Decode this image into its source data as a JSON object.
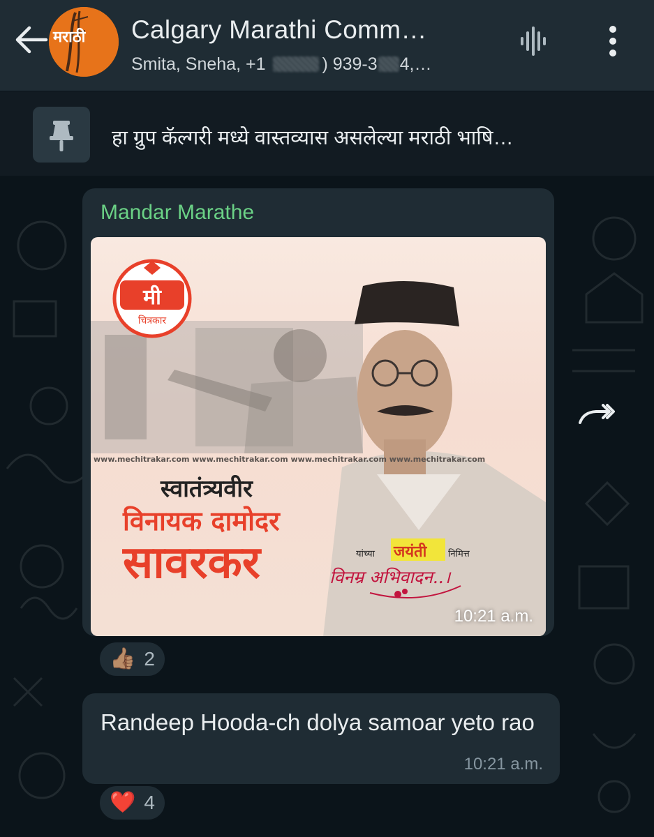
{
  "header": {
    "back_icon": "arrow-left-icon",
    "title": "Calgary Marathi Comm…",
    "subtitle_start": "Smita, Sneha, +1",
    "subtitle_end": ") 939-3",
    "subtitle_tail": "4,…",
    "voice_icon": "voice-waveform-icon",
    "menu_icon": "more-vertical-icon",
    "avatar_text": "मराठी"
  },
  "pinned": {
    "icon": "pin-icon",
    "text": "हा ग्रुप कॅल्गरी मध्ये वास्तव्यास असलेल्या मराठी भाषि…"
  },
  "messages": [
    {
      "sender": "Mandar Marathe",
      "type": "image",
      "time": "10:21 a.m.",
      "image": {
        "logo_text": "मी",
        "logo_sub": "चित्रकार",
        "watermark": "www.mechitrakar.com www.mechitrakar.com www.mechitrakar.com www.mechitrakar.com",
        "line1": "स्वातंत्र्यवीर",
        "line2": "विनायक दामोदर",
        "line3": "सावरकर",
        "yanchya": "यांच्या",
        "jayanti": "जयंती",
        "nimitta": "निमित्त",
        "abhivadan": "विनम्र अभिवादन..।"
      },
      "reaction": {
        "emoji": "👍🏽",
        "count": "2"
      }
    },
    {
      "type": "text",
      "text": "Randeep Hooda-ch dolya samoar yeto rao",
      "time": "10:21 a.m.",
      "reaction": {
        "emoji": "❤️",
        "count": "4"
      }
    }
  ],
  "forward_icon": "forward-icon",
  "colors": {
    "header_bg": "#1f2c34",
    "chat_bg": "#0b141a",
    "bubble_bg": "#1f2c34",
    "sender_name": "#6bd286",
    "title_red": "#e8402a"
  }
}
